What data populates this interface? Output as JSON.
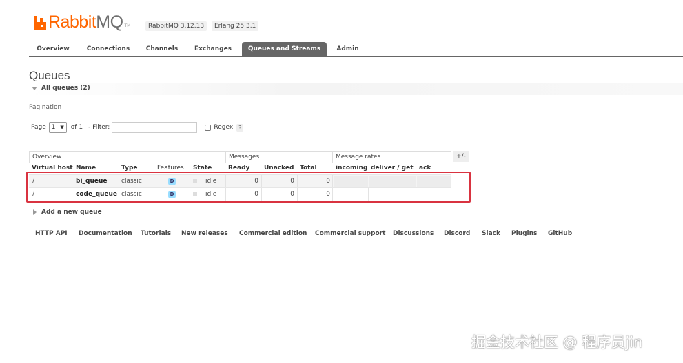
{
  "header": {
    "logo_rabbit": "Rabbit",
    "logo_mq": "MQ",
    "logo_tm": "TM",
    "rabbitmq_version": "RabbitMQ 3.12.13",
    "erlang_version": "Erlang 25.3.1"
  },
  "tabs": [
    {
      "label": "Overview",
      "active": false
    },
    {
      "label": "Connections",
      "active": false
    },
    {
      "label": "Channels",
      "active": false
    },
    {
      "label": "Exchanges",
      "active": false
    },
    {
      "label": "Queues and Streams",
      "active": true
    },
    {
      "label": "Admin",
      "active": false
    }
  ],
  "page_title": "Queues",
  "all_queues_label": "All queues (2)",
  "pagination": {
    "label": "Pagination",
    "page_label": "Page",
    "page_value": "1",
    "of_label": "of 1",
    "filter_label": "- Filter:",
    "filter_value": "",
    "regex_label": "Regex",
    "help_label": "?"
  },
  "table": {
    "groups": [
      "Overview",
      "Messages",
      "Message rates"
    ],
    "plus_minus": "+/-",
    "columns": [
      "Virtual host",
      "Name",
      "Type",
      "Features",
      "State",
      "Ready",
      "Unacked",
      "Total",
      "incoming",
      "deliver / get",
      "ack"
    ],
    "rows": [
      {
        "vhost": "/",
        "name": "bi_queue",
        "type": "classic",
        "feature": "D",
        "state": "idle",
        "ready": "0",
        "unacked": "0",
        "total": "0"
      },
      {
        "vhost": "/",
        "name": "code_queue",
        "type": "classic",
        "feature": "D",
        "state": "idle",
        "ready": "0",
        "unacked": "0",
        "total": "0"
      }
    ]
  },
  "add_queue_label": "Add a new queue",
  "footer_links": [
    "HTTP API",
    "Documentation",
    "Tutorials",
    "New releases",
    "Commercial edition",
    "Commercial support",
    "Discussions",
    "Discord",
    "Slack",
    "Plugins",
    "GitHub"
  ],
  "watermark": "掘金技术社区 @ 程序员jin",
  "colors": {
    "brand_orange": "#ff6600",
    "active_tab": "#666666",
    "feature_badge": "#99ddff",
    "highlight_red": "#d93340"
  }
}
